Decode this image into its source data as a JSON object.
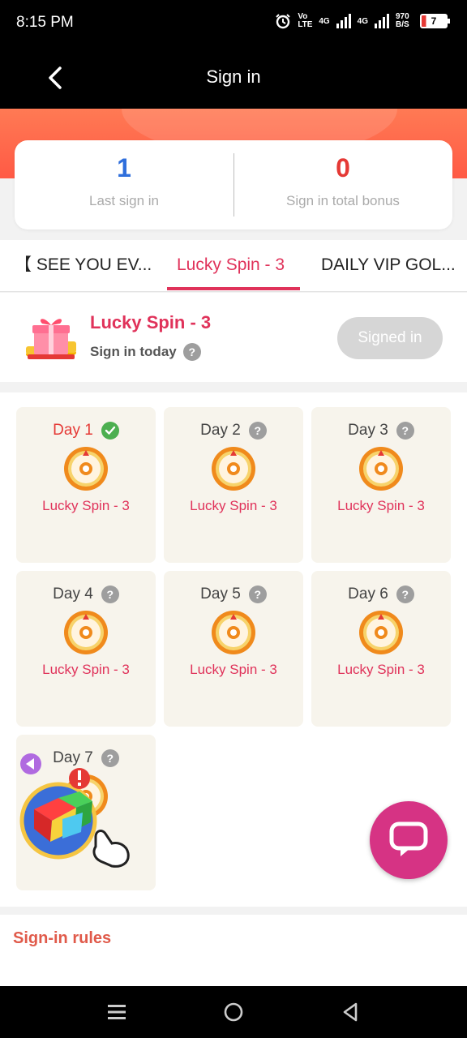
{
  "status_bar": {
    "time": "8:15 PM",
    "network_1": "Vo LTE",
    "network_2": "4G",
    "network_3": "4G",
    "speed": "970 B/S",
    "battery": "7"
  },
  "header": {
    "title": "Sign in"
  },
  "summary": {
    "last_sign_in_value": "1",
    "last_sign_in_label": "Last sign in",
    "bonus_value": "0",
    "bonus_label": "Sign in total bonus"
  },
  "colors": {
    "accent": "#e0325a",
    "value_blue": "#2f6fdc",
    "value_red": "#e53935",
    "chat_fab": "#d63384",
    "check": "#4caf50"
  },
  "tabs": [
    {
      "label": "【 SEE YOU EV..."
    },
    {
      "label": "Lucky Spin - 3",
      "active": true
    },
    {
      "label": "DAILY VIP GOL..."
    }
  ],
  "today": {
    "title": "Lucky Spin - 3",
    "subtitle": "Sign in today",
    "button_label": "Signed in"
  },
  "days": [
    {
      "label": "Day 1",
      "reward": "Lucky Spin - 3",
      "status": "signed"
    },
    {
      "label": "Day 2",
      "reward": "Lucky Spin - 3",
      "status": "pending"
    },
    {
      "label": "Day 3",
      "reward": "Lucky Spin - 3",
      "status": "pending"
    },
    {
      "label": "Day 4",
      "reward": "Lucky Spin - 3",
      "status": "pending"
    },
    {
      "label": "Day 5",
      "reward": "Lucky Spin - 3",
      "status": "pending"
    },
    {
      "label": "Day 6",
      "reward": "Lucky Spin - 3",
      "status": "pending"
    },
    {
      "label": "Day 7",
      "reward": "",
      "status": "pending"
    }
  ],
  "rules": {
    "title": "Sign-in rules"
  },
  "icons": {
    "back": "chevron-left-icon",
    "help": "question-icon",
    "check": "check-icon",
    "wheel": "lucky-wheel-icon",
    "gift": "gift-icon",
    "chat": "chat-icon",
    "nav_menu": "menu-icon",
    "nav_home": "home-circle-icon",
    "nav_back": "triangle-back-icon"
  }
}
